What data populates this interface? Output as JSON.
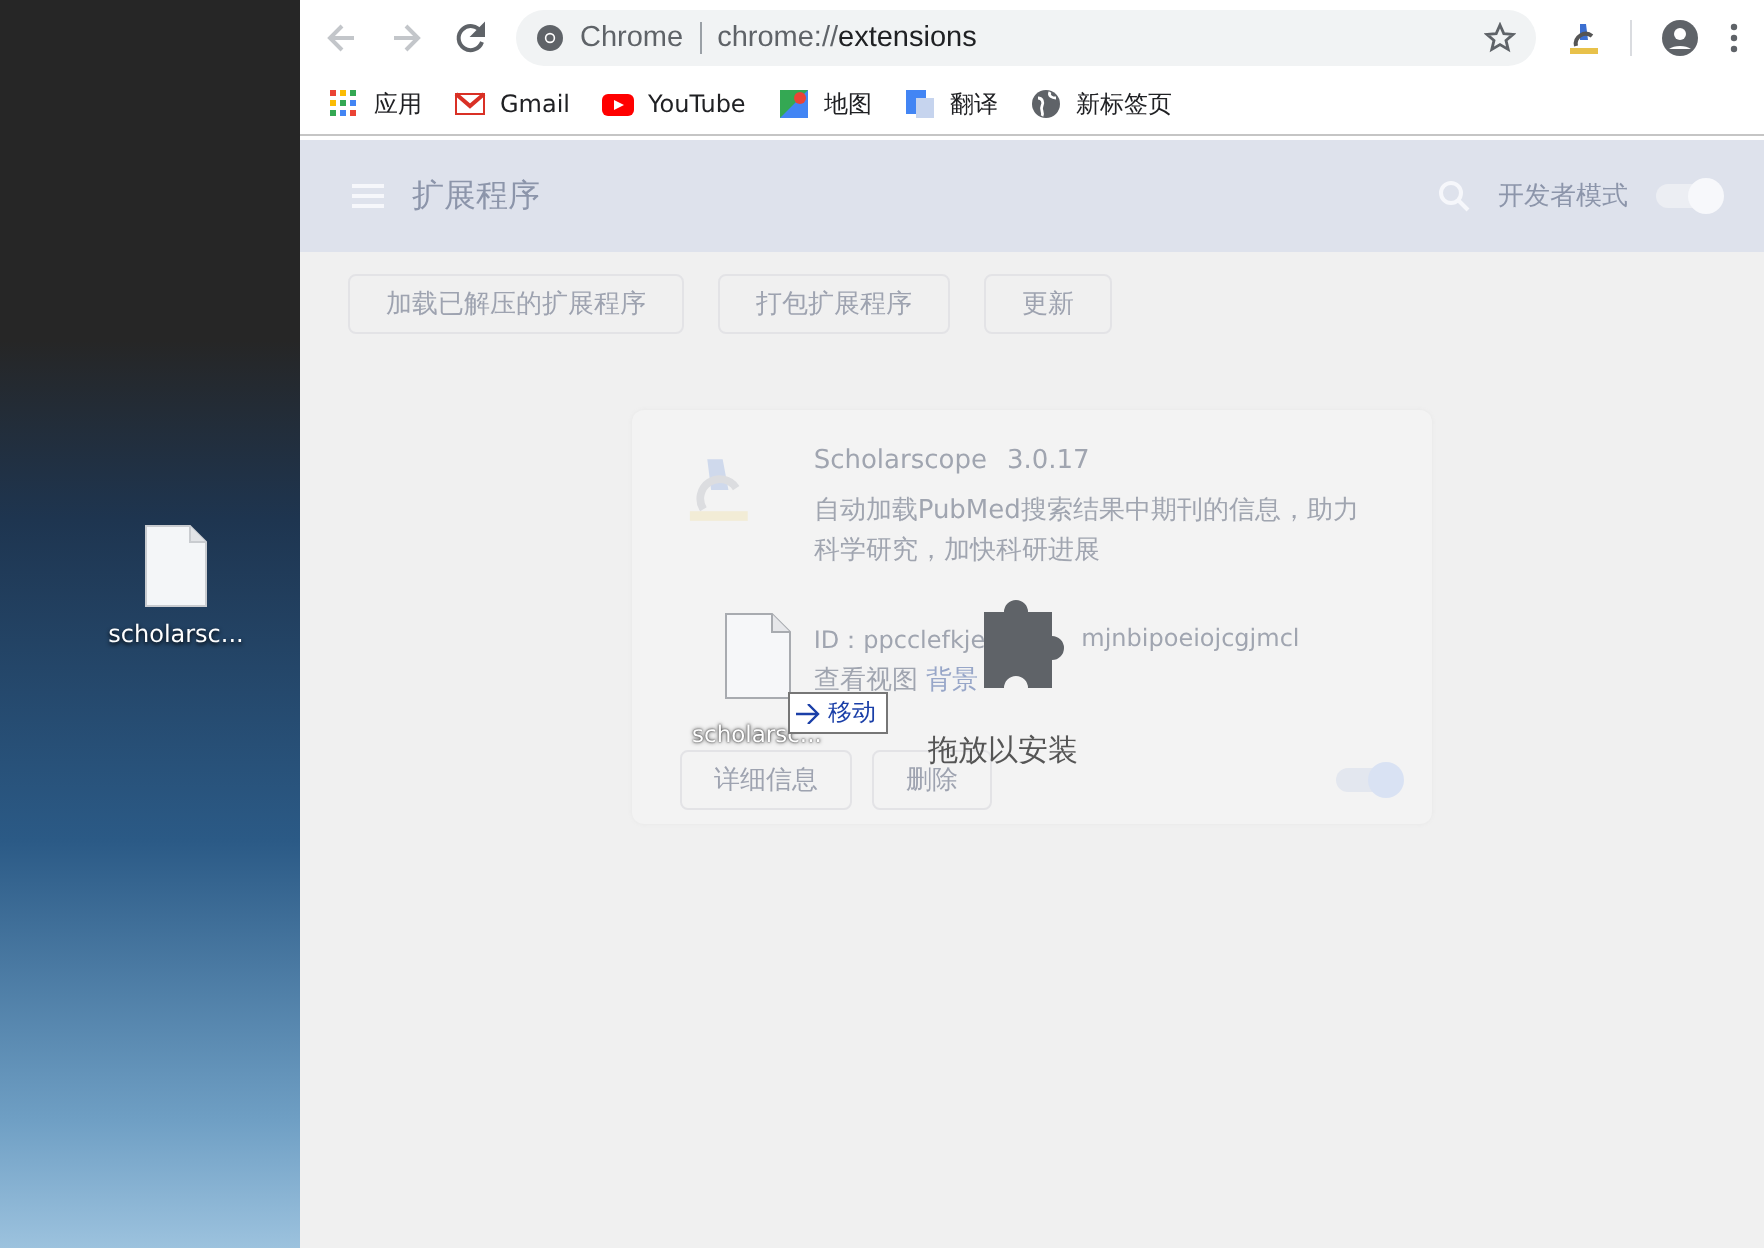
{
  "desktop": {
    "icons": [
      {
        "label": "scholarsc..."
      }
    ]
  },
  "toolbar": {
    "back": {
      "disabled": true
    },
    "forward": {
      "disabled": true
    },
    "omnibox": {
      "site_label": "Chrome",
      "url_scheme": "chrome://",
      "url_path": "extensions"
    }
  },
  "bookmarks": [
    {
      "kind": "apps",
      "label": "应用"
    },
    {
      "kind": "gmail",
      "label": "Gmail"
    },
    {
      "kind": "youtube",
      "label": "YouTube"
    },
    {
      "kind": "maps",
      "label": "地图"
    },
    {
      "kind": "translate",
      "label": "翻译"
    },
    {
      "kind": "globe",
      "label": "新标签页"
    }
  ],
  "header": {
    "title": "扩展程序",
    "dev_mode_label": "开发者模式",
    "dev_mode_on": true
  },
  "actions": [
    "加载已解压的扩展程序",
    "打包扩展程序",
    "更新"
  ],
  "card": {
    "name": "Scholarscope",
    "version": "3.0.17",
    "description": "自动加载PubMed搜索结果中期刊的信息，助力科学研究，加快科研进展",
    "id_left": "ID：ppcclefkje",
    "id_right": "mjnbipoeiojcgjmcl",
    "views_label": "查看视图",
    "views_link": "背景",
    "buttons": [
      "详细信息",
      "删除"
    ],
    "enabled": true
  },
  "drop_overlay": {
    "label": "拖放以安装"
  },
  "drag": {
    "file_label": "scholarsc...",
    "effect_label": "移动"
  }
}
